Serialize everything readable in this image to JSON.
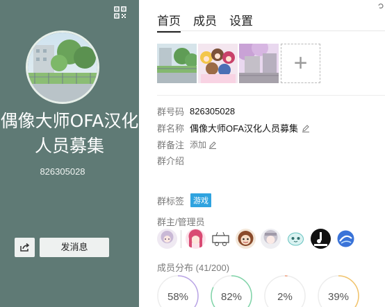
{
  "left_panel": {
    "group_name": "偶像大师OFA汉化人员募集",
    "group_number": "826305028",
    "send_message_label": "发消息",
    "background_color": "#5f7a75"
  },
  "tabs": [
    {
      "label": "首页",
      "active": true
    },
    {
      "label": "成员",
      "active": false
    },
    {
      "label": "设置",
      "active": false
    }
  ],
  "add_photo_symbol": "+",
  "info": {
    "number_label": "群号码",
    "number_value": "826305028",
    "name_label": "群名称",
    "name_value": "偶像大师OFA汉化人员募集",
    "remark_label": "群备注",
    "remark_add": "添加",
    "intro_label": "群介绍"
  },
  "tags": {
    "label": "群标签",
    "items": [
      "游戏"
    ],
    "tag_color": "#2fa3df"
  },
  "admins": {
    "label": "群主/管理员"
  },
  "distribution": {
    "label": "成员分布",
    "count": "(41/200)",
    "gauges": [
      {
        "text": "58%",
        "value": 58,
        "color": "#b9a4e6"
      },
      {
        "text": "82%",
        "value": 82,
        "color": "#7fd4a8"
      },
      {
        "text": "2%",
        "value": 2,
        "color": "#f1a07f"
      },
      {
        "text": "39%",
        "value": 39,
        "color": "#f2c36a"
      }
    ]
  }
}
